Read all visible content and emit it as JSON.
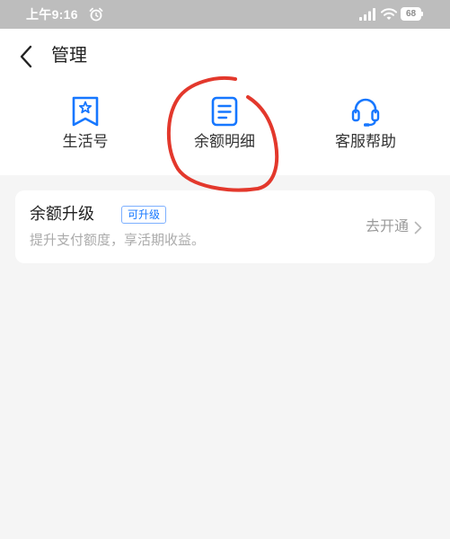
{
  "status_bar": {
    "time": "上午9:16",
    "battery": "68",
    "icons": [
      "alarm-icon",
      "signal-icon",
      "wifi-icon",
      "battery-icon"
    ]
  },
  "header": {
    "title": "管理",
    "back_icon": "chevron-left-icon"
  },
  "quick_actions": [
    {
      "label": "生活号",
      "icon": "star-badge-icon"
    },
    {
      "label": "余额明细",
      "icon": "document-icon"
    },
    {
      "label": "客服帮助",
      "icon": "headset-icon"
    }
  ],
  "upgrade_card": {
    "title": "余额升级",
    "badge": "可升级",
    "subtitle": "提升支付额度，享活期收益。",
    "action": "去开通",
    "action_icon": "chevron-right-icon"
  },
  "colors": {
    "accent": "#1677ff",
    "annotation": "#e3382c",
    "status_bar_bg": "#bdbdbd",
    "page_bg": "#f5f5f5"
  }
}
